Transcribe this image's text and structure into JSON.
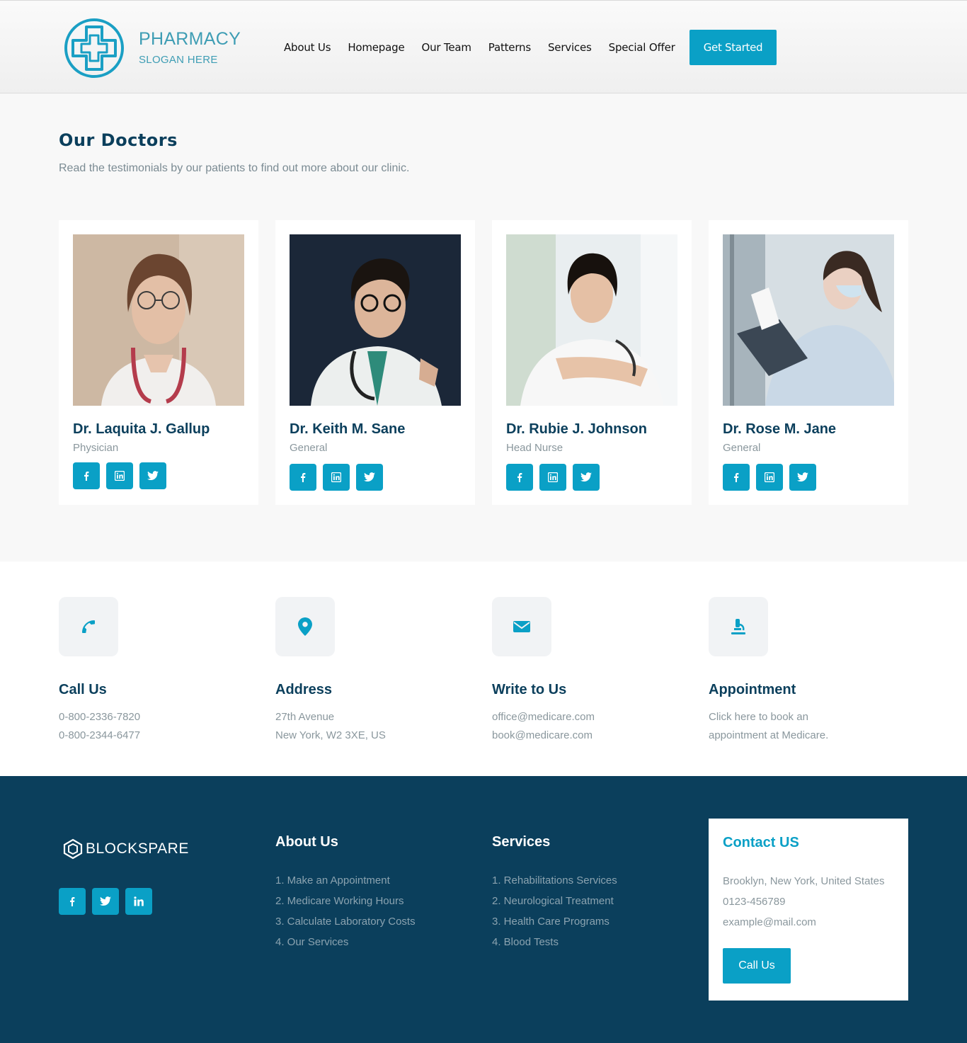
{
  "brand": {
    "name": "PHARMACY",
    "slogan": "SLOGAN HERE"
  },
  "nav": {
    "items": [
      "About Us",
      "Homepage",
      "Our Team",
      "Patterns",
      "Services",
      "Special Offer"
    ],
    "cta": "Get Started"
  },
  "doctors": {
    "title": "Our Doctors",
    "subtitle": "Read the testimonials by our patients to find out more about our clinic.",
    "cards": [
      {
        "name": "Dr. Laquita J. Gallup",
        "role": "Physician"
      },
      {
        "name": "Dr. Keith M. Sane",
        "role": "General"
      },
      {
        "name": "Dr. Rubie J. Johnson",
        "role": "Head Nurse"
      },
      {
        "name": "Dr. Rose M. Jane",
        "role": "General"
      }
    ]
  },
  "info": [
    {
      "title": "Call Us",
      "lines": [
        "0-800-2336-7820",
        "0-800-2344-6477"
      ],
      "icon": "phone-icon"
    },
    {
      "title": "Address",
      "lines": [
        "27th Avenue",
        "New York, W2 3XE, US"
      ],
      "icon": "map-pin-icon"
    },
    {
      "title": "Write to Us",
      "lines": [
        "office@medicare.com",
        "book@medicare.com"
      ],
      "icon": "envelope-icon"
    },
    {
      "title": "Appointment",
      "lines": [
        "Click here to book an",
        "appointment at Medicare."
      ],
      "icon": "microscope-icon"
    }
  ],
  "footer": {
    "brand": "BLOCKSPARE",
    "about": {
      "title": "About Us",
      "items": [
        "1. Make an Appointment",
        "2. Medicare Working Hours",
        "3. Calculate Laboratory Costs",
        "4. Our Services"
      ]
    },
    "services": {
      "title": "Services",
      "items": [
        "1. Rehabilitations Services",
        "2. Neurological Treatment",
        "3. Health Care Programs",
        "4. Blood Tests"
      ]
    },
    "contact": {
      "title": "Contact US",
      "lines": [
        "Brooklyn, New York, United States",
        "0123-456789",
        "example@mail.com"
      ],
      "button": "Call Us"
    }
  },
  "colors": {
    "accent": "#0aa0c6",
    "navy": "#0b3f5c",
    "muted": "#8a979d"
  }
}
